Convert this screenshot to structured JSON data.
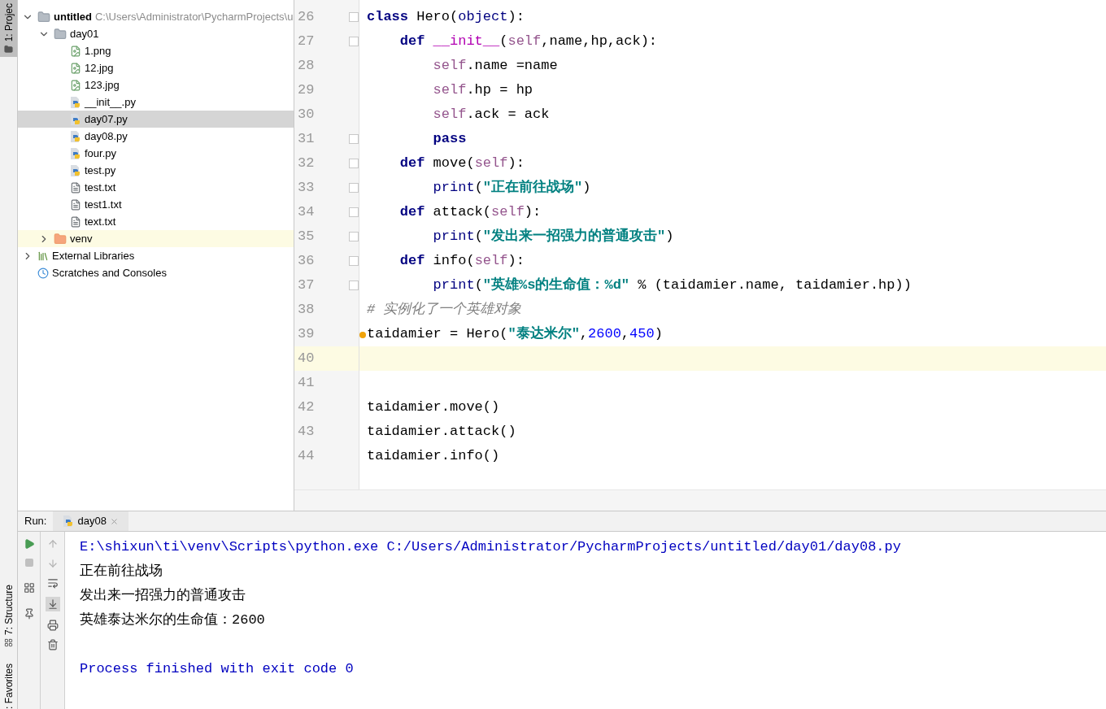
{
  "side_strip": {
    "top": "1: Projec",
    "middle": "7: Structure",
    "bottom": ": Favorites"
  },
  "project_tree": {
    "items": [
      {
        "label": "untitled",
        "path": "C:\\Users\\Administrator\\PycharmProjects\\u",
        "kind": "project",
        "expanded": true,
        "selected": false,
        "children": [
          {
            "label": "day01",
            "kind": "package",
            "expanded": true,
            "selected": false,
            "children": [
              {
                "label": "1.png",
                "kind": "image",
                "selected": false
              },
              {
                "label": "12.jpg",
                "kind": "image",
                "selected": false
              },
              {
                "label": "123.jpg",
                "kind": "image",
                "selected": false
              },
              {
                "label": "__init__.py",
                "kind": "python",
                "selected": false
              },
              {
                "label": "day07.py",
                "kind": "python",
                "selected": true
              },
              {
                "label": "day08.py",
                "kind": "python",
                "selected": false
              },
              {
                "label": "four.py",
                "kind": "python",
                "selected": false
              },
              {
                "label": "test.py",
                "kind": "python",
                "selected": false
              },
              {
                "label": "test.txt",
                "kind": "text",
                "selected": false
              },
              {
                "label": "test1.txt",
                "kind": "text",
                "selected": false
              },
              {
                "label": "text.txt",
                "kind": "text",
                "selected": false
              }
            ]
          },
          {
            "label": "venv",
            "kind": "folder",
            "expanded": false,
            "selected": false,
            "highlighted": true
          }
        ]
      },
      {
        "label": "External Libraries",
        "kind": "libraries",
        "expanded": false,
        "selected": false
      },
      {
        "label": "Scratches and Consoles",
        "kind": "scratches",
        "selected": false
      }
    ]
  },
  "editor": {
    "lines": [
      {
        "number": "26",
        "fold": true,
        "current": false,
        "tokens": [
          {
            "kind": "keyword",
            "text": "class"
          },
          {
            "kind": "plain",
            "text": " Hero("
          },
          {
            "kind": "builtin",
            "text": "object"
          },
          {
            "kind": "plain",
            "text": "):"
          }
        ],
        "children": [
          {
            "number": "27",
            "fold": true,
            "current": false,
            "tokens": [
              {
                "kind": "keyword",
                "text": "def"
              },
              {
                "kind": "magic",
                "text": " __init__"
              },
              {
                "kind": "plain",
                "text": "("
              },
              {
                "kind": "self",
                "text": "self"
              },
              {
                "kind": "plain",
                "text": ",name,hp,ack):"
              }
            ],
            "children": [
              {
                "number": "28",
                "fold": false,
                "current": false,
                "tokens": [
                  {
                    "kind": "self",
                    "text": "self"
                  },
                  {
                    "kind": "plain",
                    "text": ".name =name"
                  }
                ]
              },
              {
                "number": "29",
                "fold": false,
                "current": false,
                "tokens": [
                  {
                    "kind": "self",
                    "text": "self"
                  },
                  {
                    "kind": "plain",
                    "text": ".hp = hp"
                  }
                ]
              },
              {
                "number": "30",
                "fold": false,
                "current": false,
                "tokens": [
                  {
                    "kind": "self",
                    "text": "self"
                  },
                  {
                    "kind": "plain",
                    "text": ".ack = ack"
                  }
                ]
              },
              {
                "number": "31",
                "fold": true,
                "current": false,
                "tokens": [
                  {
                    "kind": "keyword",
                    "text": "pass"
                  }
                ]
              }
            ]
          },
          {
            "number": "32",
            "fold": true,
            "current": false,
            "tokens": [
              {
                "kind": "keyword",
                "text": "def"
              },
              {
                "kind": "plain",
                "text": " move("
              },
              {
                "kind": "self",
                "text": "self"
              },
              {
                "kind": "plain",
                "text": "):"
              }
            ],
            "children": [
              {
                "number": "33",
                "fold": true,
                "current": false,
                "tokens": [
                  {
                    "kind": "builtin",
                    "text": "print"
                  },
                  {
                    "kind": "plain",
                    "text": "("
                  },
                  {
                    "kind": "string",
                    "text": "\"正在前往战场\""
                  },
                  {
                    "kind": "plain",
                    "text": ")"
                  }
                ]
              }
            ]
          },
          {
            "number": "34",
            "fold": true,
            "current": false,
            "tokens": [
              {
                "kind": "keyword",
                "text": "def"
              },
              {
                "kind": "plain",
                "text": " attack("
              },
              {
                "kind": "self",
                "text": "self"
              },
              {
                "kind": "plain",
                "text": "):"
              }
            ],
            "children": [
              {
                "number": "35",
                "fold": true,
                "current": false,
                "tokens": [
                  {
                    "kind": "builtin",
                    "text": "print"
                  },
                  {
                    "kind": "plain",
                    "text": "("
                  },
                  {
                    "kind": "string",
                    "text": "\"发出来一招强力的普通攻击\""
                  },
                  {
                    "kind": "plain",
                    "text": ")"
                  }
                ]
              }
            ]
          },
          {
            "number": "36",
            "fold": true,
            "current": false,
            "tokens": [
              {
                "kind": "keyword",
                "text": "def"
              },
              {
                "kind": "plain",
                "text": " info("
              },
              {
                "kind": "self",
                "text": "self"
              },
              {
                "kind": "plain",
                "text": "):"
              }
            ],
            "children": [
              {
                "number": "37",
                "fold": true,
                "current": false,
                "tokens": [
                  {
                    "kind": "builtin",
                    "text": "print"
                  },
                  {
                    "kind": "plain",
                    "text": "("
                  },
                  {
                    "kind": "string",
                    "text": "\"英雄%s的生命值：%d\""
                  },
                  {
                    "kind": "plain",
                    "text": " % (taidamier.name, taidamier.hp))"
                  }
                ]
              }
            ]
          }
        ]
      },
      {
        "number": "38",
        "fold": false,
        "current": false,
        "tokens": [
          {
            "kind": "comment",
            "text": "# 实例化了一个英雄对象"
          }
        ]
      },
      {
        "number": "39",
        "fold": false,
        "current": false,
        "bulb": true,
        "tokens": [
          {
            "kind": "plain",
            "text": "taidamier = Hero("
          },
          {
            "kind": "string",
            "text": "\"泰达米尔\""
          },
          {
            "kind": "plain",
            "text": ","
          },
          {
            "kind": "number",
            "text": "2600"
          },
          {
            "kind": "plain",
            "text": ","
          },
          {
            "kind": "number",
            "text": "450"
          },
          {
            "kind": "plain",
            "text": ")"
          }
        ]
      },
      {
        "number": "40",
        "fold": false,
        "current": true
      },
      {
        "number": "41",
        "fold": false,
        "current": false
      },
      {
        "number": "42",
        "fold": false,
        "current": false,
        "tokens": [
          {
            "kind": "plain",
            "text": "taidamier.move()"
          }
        ]
      },
      {
        "number": "43",
        "fold": false,
        "current": false,
        "tokens": [
          {
            "kind": "plain",
            "text": "taidamier.attack()"
          }
        ]
      },
      {
        "number": "44",
        "fold": false,
        "current": false,
        "tokens": [
          {
            "kind": "plain",
            "text": "taidamier.info()"
          }
        ]
      }
    ]
  },
  "run_panel": {
    "label": "Run:",
    "tab": {
      "label": "day08",
      "selected": true
    },
    "output": [
      {
        "kind": "command",
        "text": "E:\\shixun\\ti\\venv\\Scripts\\python.exe C:/Users/Administrator/PycharmProjects/untitled/day01/day08.py"
      },
      {
        "kind": "stdout",
        "text": "正在前往战场"
      },
      {
        "kind": "stdout",
        "text": "发出来一招强力的普通攻击"
      },
      {
        "kind": "stdout",
        "text": "英雄泰达米尔的生命值：2600"
      },
      {
        "kind": "blank"
      },
      {
        "kind": "system",
        "text": "Process finished with exit code 0"
      }
    ]
  }
}
